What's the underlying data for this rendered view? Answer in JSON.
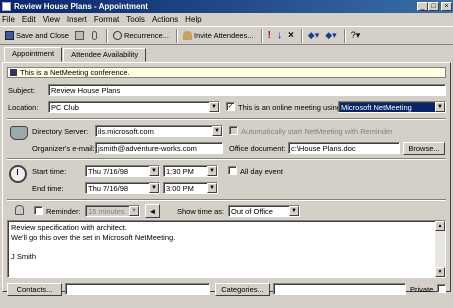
{
  "window": {
    "title": "Review House Plans - Appointment",
    "controls": [
      "_",
      "□",
      "×"
    ]
  },
  "menu": [
    "File",
    "Edit",
    "View",
    "Insert",
    "Format",
    "Tools",
    "Actions",
    "Help"
  ],
  "toolbar": {
    "save_close": "Save and Close",
    "recurrence": "Recurrence...",
    "invite": "Invite Attendees..."
  },
  "tabs": [
    "Appointment",
    "Attendee Availability"
  ],
  "info_bar": "This is a NetMeeting conference.",
  "form": {
    "subject_label": "Subject:",
    "subject_value": "Review House Plans",
    "location_label": "Location:",
    "location_value": "PC Club",
    "online_label": "This is an online meeting using:",
    "online_value": "Microsoft NetMeeting",
    "directory_label": "Directory Server:",
    "directory_value": "ils.microsoft.com",
    "auto_start_label": "Automatically start NetMeeting with Reminder",
    "organizer_label": "Organizer's e-mail:",
    "organizer_value": "jsmith@adventure-works.com",
    "office_doc_label": "Office document:",
    "office_doc_value": "c:\\House Plans.doc",
    "browse": "Browse...",
    "start_label": "Start time:",
    "start_date": "Thu 7/16/98",
    "start_time": "1:30 PM",
    "end_label": "End time:",
    "end_date": "Thu 7/16/98",
    "end_time": "3:00 PM",
    "all_day": "All day event",
    "reminder_label": "Reminder:",
    "reminder_value": "15 minutes",
    "show_as_label": "Show time as:",
    "show_as_value": "Out of Office",
    "notes": [
      "Review specification with architect.",
      "We'll go this over the set in Microsoft NetMeeting.",
      "",
      "J Smith"
    ],
    "contacts_btn": "Contacts...",
    "categories_btn": "Categories...",
    "private_label": "Private"
  }
}
